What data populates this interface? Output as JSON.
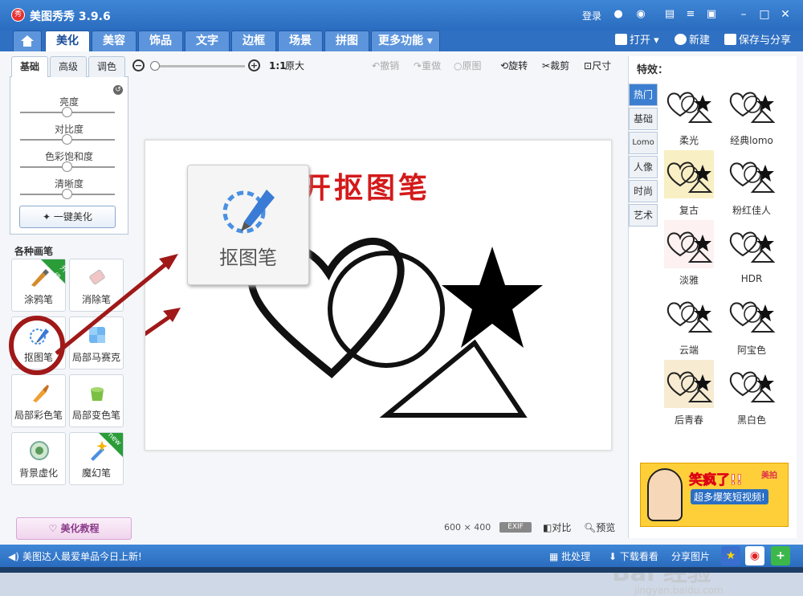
{
  "window": {
    "logo": "秀",
    "title": "美图秀秀 3.9.6",
    "login": "登录"
  },
  "tabs": [
    {
      "label": "美化"
    },
    {
      "label": "美容"
    },
    {
      "label": "饰品"
    },
    {
      "label": "文字"
    },
    {
      "label": "边框"
    },
    {
      "label": "场景"
    },
    {
      "label": "拼图"
    },
    {
      "label": "更多功能 ▾"
    }
  ],
  "file_tools": {
    "open": "打开",
    "new": "新建",
    "save": "保存与分享"
  },
  "adjust": {
    "tabs": [
      "基础",
      "高级",
      "调色"
    ],
    "sliders": [
      "亮度",
      "对比度",
      "色彩饱和度",
      "清晰度"
    ],
    "one_key": "一键美化"
  },
  "pens": {
    "title": "各种画笔",
    "items": [
      {
        "label": "涂鸦笔",
        "badge": "升级"
      },
      {
        "label": "消除笔",
        "badge": ""
      },
      {
        "label": "抠图笔",
        "badge": ""
      },
      {
        "label": "局部马赛克",
        "badge": ""
      },
      {
        "label": "局部彩色笔",
        "badge": ""
      },
      {
        "label": "局部变色笔",
        "badge": ""
      },
      {
        "label": "背景虚化",
        "badge": ""
      },
      {
        "label": "魔幻笔",
        "badge": "new"
      }
    ],
    "tutorial": "美化教程"
  },
  "toolbar": {
    "zoom_ratio": "1:1",
    "original_size": "原大",
    "undo": "撤销",
    "redo": "重做",
    "original": "原图",
    "rotate": "旋转",
    "crop": "裁剪",
    "resize": "尺寸"
  },
  "canvas": {
    "title": "打开抠图笔",
    "popup_label": "抠图笔",
    "size_w": "600",
    "size_x": "×",
    "size_h": "400",
    "exif": "EXIF",
    "compare": "对比",
    "preview": "预览"
  },
  "effects": {
    "title": "特效：",
    "categories": [
      "热门",
      "基础",
      "Lomo",
      "人像",
      "时尚",
      "艺术"
    ],
    "items": [
      {
        "label": "柔光",
        "tint": "#ffffff"
      },
      {
        "label": "经典lomo",
        "tint": "#ffffff"
      },
      {
        "label": "复古",
        "tint": "#f9efc4"
      },
      {
        "label": "粉红佳人",
        "tint": "#ffffff"
      },
      {
        "label": "淡雅",
        "tint": "#fdf1f1"
      },
      {
        "label": "HDR",
        "tint": "#ffffff"
      },
      {
        "label": "云端",
        "tint": "#ffffff"
      },
      {
        "label": "阿宝色",
        "tint": "#ffffff"
      },
      {
        "label": "后青春",
        "tint": "#f7ecd2"
      },
      {
        "label": "黑白色",
        "tint": "#ffffff"
      }
    ],
    "ad": {
      "headline": "笑疯了!!",
      "sub": "超多爆笑短视频!",
      "brand": "美拍"
    }
  },
  "status": {
    "message": "美图达人最爱单品今日上新!",
    "batch": "批处理",
    "download": "下载看看",
    "share": "分享图片"
  },
  "watermark": {
    "main": "Bai 经验",
    "url": "jingyan.baidu.com"
  },
  "colors": {
    "accent": "#2a6cbf",
    "highlight_red": "#d41a1a",
    "tab_active_text": "#1b4f9a"
  }
}
